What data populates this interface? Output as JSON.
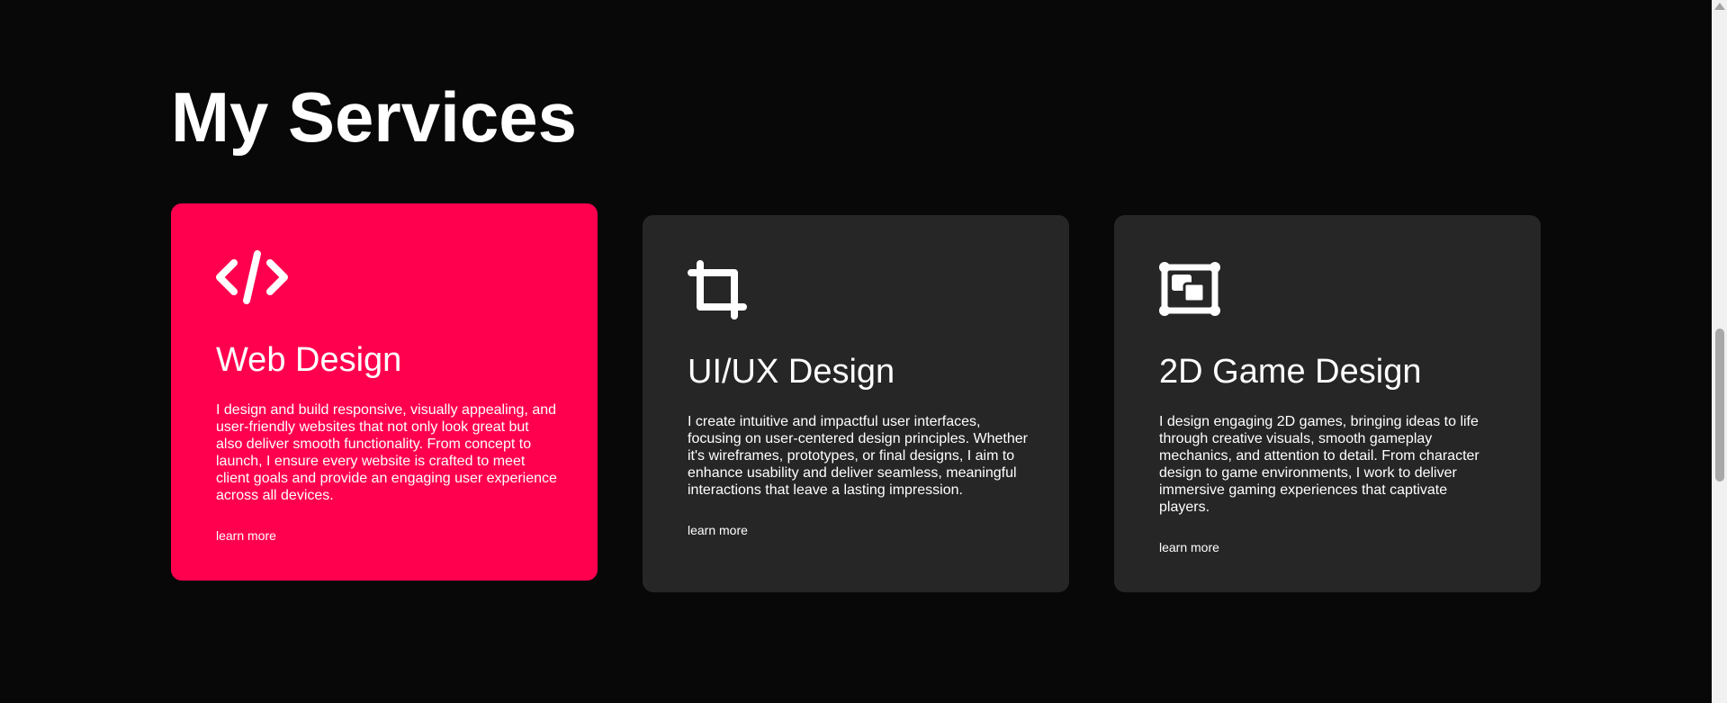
{
  "section": {
    "title": "My Services"
  },
  "services": [
    {
      "icon": "code-icon",
      "title": "Web Design",
      "description": "I design and build responsive, visually appealing, and user-friendly websites that not only look great but also deliver smooth functionality. From concept to launch, I ensure every website is crafted to meet client goals and provide an engaging user experience across all devices.",
      "link": "learn more"
    },
    {
      "icon": "crop-icon",
      "title": "UI/UX Design",
      "description": "I create intuitive and impactful user interfaces, focusing on user-centered design principles. Whether it's wireframes, prototypes, or final designs, I aim to enhance usability and deliver seamless, meaningful interactions that leave a lasting impression.",
      "link": "learn more"
    },
    {
      "icon": "layers-icon",
      "title": "2D Game Design",
      "description": "I design engaging 2D games, bringing ideas to life through creative visuals, smooth gameplay mechanics, and attention to detail. From character design to game environments, I work to deliver immersive gaming experiences that captivate players.",
      "link": "learn more"
    }
  ],
  "colors": {
    "background": "#080808",
    "card": "#262626",
    "accent": "#ff004f"
  }
}
